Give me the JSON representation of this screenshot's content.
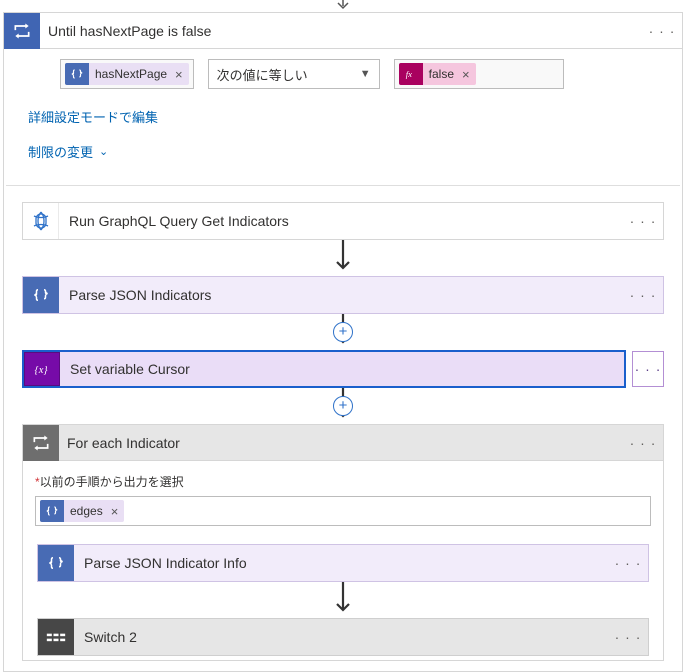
{
  "header": {
    "title": "Until hasNextPage is false"
  },
  "condition": {
    "left_token": "hasNextPage",
    "operator": "次の値に等しい",
    "right_token": "false"
  },
  "links": {
    "edit_advanced": "詳細設定モードで編集",
    "change_limit": "制限の変更"
  },
  "actions": {
    "run_graphql": "Run GraphQL Query Get Indicators",
    "parse_json_ind": "Parse JSON Indicators",
    "set_var_cursor": "Set variable Cursor"
  },
  "foreach": {
    "title": "For each Indicator",
    "select_label": "以前の手順から出力を選択",
    "token": "edges",
    "parse_info": "Parse JSON Indicator Info",
    "switch2": "Switch 2"
  },
  "icons": {
    "loop": "loop-icon",
    "braces": "code-braces-icon",
    "fx": "fx-icon",
    "variable": "variable-icon",
    "foreach": "foreach-icon",
    "switch": "switch-icon",
    "connector": "connector-icon"
  }
}
